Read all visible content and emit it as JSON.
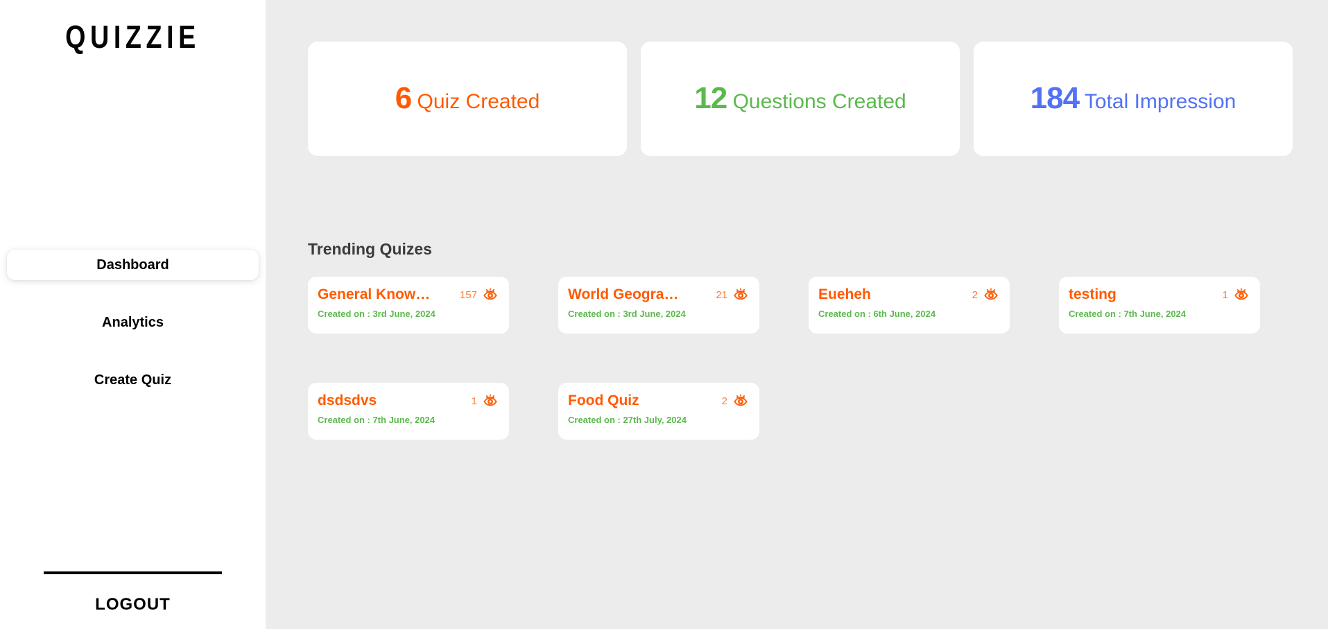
{
  "brand": {
    "logo": "QUIZZIE"
  },
  "sidebar": {
    "items": [
      {
        "label": "Dashboard",
        "active": true
      },
      {
        "label": "Analytics",
        "active": false
      },
      {
        "label": "Create Quiz",
        "active": false
      }
    ],
    "logout_label": "LOGOUT"
  },
  "stats": [
    {
      "number": "6",
      "label": "Quiz Created",
      "color": "#ff5a00"
    },
    {
      "number": "12",
      "label": "Questions Created",
      "color": "#5bb94c"
    },
    {
      "number": "184",
      "label": "Total Impression",
      "color": "#5271f5"
    }
  ],
  "trending": {
    "title": "Trending Quizes",
    "date_prefix": "Created on : ",
    "quizzes": [
      {
        "name": "General Know…",
        "views": "157",
        "date": "3rd June, 2024",
        "created": "Created on : 3rd June, 2024"
      },
      {
        "name": "World Geogra…",
        "views": "21",
        "date": "3rd June, 2024",
        "created": "Created on : 3rd June, 2024"
      },
      {
        "name": "Eueheh",
        "views": "2",
        "date": "6th June, 2024",
        "created": "Created on : 6th June, 2024"
      },
      {
        "name": "testing",
        "views": "1",
        "date": "7th June, 2024",
        "created": "Created on : 7th June, 2024"
      },
      {
        "name": "dsdsdvs",
        "views": "1",
        "date": "7th June, 2024",
        "created": "Created on : 7th June, 2024"
      },
      {
        "name": "Food Quiz",
        "views": "2",
        "date": "27th July, 2024",
        "created": "Created on : 27th July, 2024"
      }
    ]
  },
  "icons": {
    "views": "eye-icon"
  }
}
